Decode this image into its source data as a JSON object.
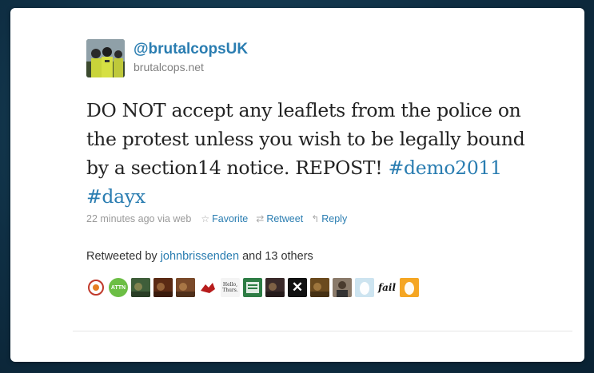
{
  "user": {
    "handle": "@brutalcopsUK",
    "site": "brutalcops.net"
  },
  "tweet": {
    "text_before": "DO NOT accept any leaflets from the police on the protest unless you wish to be legally bound by a section14 notice. REPOST! ",
    "hashtag1": "#demo2011",
    "hashtag2": "#dayx"
  },
  "meta": {
    "time": "22 minutes ago via web",
    "favorite": "Favorite",
    "retweet": "Retweet",
    "reply": "Reply"
  },
  "retweets": {
    "prefix": "Retweeted by ",
    "user": "johnbrissenden",
    "suffix": " and 13 others"
  },
  "retweeter_avatars": [
    {
      "name": "avatar-emblem",
      "color": "#ffffff"
    },
    {
      "name": "avatar-attn",
      "color": "#6cbe45",
      "text": "ATTN"
    },
    {
      "name": "avatar-green-photo",
      "color": "#3f5e3a"
    },
    {
      "name": "avatar-fire-photo",
      "color": "#5a2a14"
    },
    {
      "name": "avatar-smoke-photo",
      "color": "#7a4a2a"
    },
    {
      "name": "avatar-red-dragon",
      "color": "#ffffff"
    },
    {
      "name": "avatar-hello-text",
      "color": "#f4f4f4",
      "text": "Hello, Thurs."
    },
    {
      "name": "avatar-green-sign",
      "color": "#2e7d45"
    },
    {
      "name": "avatar-dark-photo",
      "color": "#3a2a2a"
    },
    {
      "name": "avatar-x-mark",
      "color": "#111111",
      "text": "✕"
    },
    {
      "name": "avatar-brown-photo",
      "color": "#6a4a1e"
    },
    {
      "name": "avatar-man-photo",
      "color": "#8a7a6a"
    },
    {
      "name": "avatar-egg-blue",
      "color": "#cde4f0"
    },
    {
      "name": "avatar-fail-text",
      "color": "#ffffff",
      "text": "fail"
    },
    {
      "name": "avatar-egg-orange",
      "color": "#f5a623"
    }
  ],
  "colors": {
    "link": "#2a7db1",
    "background": "#0f2f44"
  }
}
